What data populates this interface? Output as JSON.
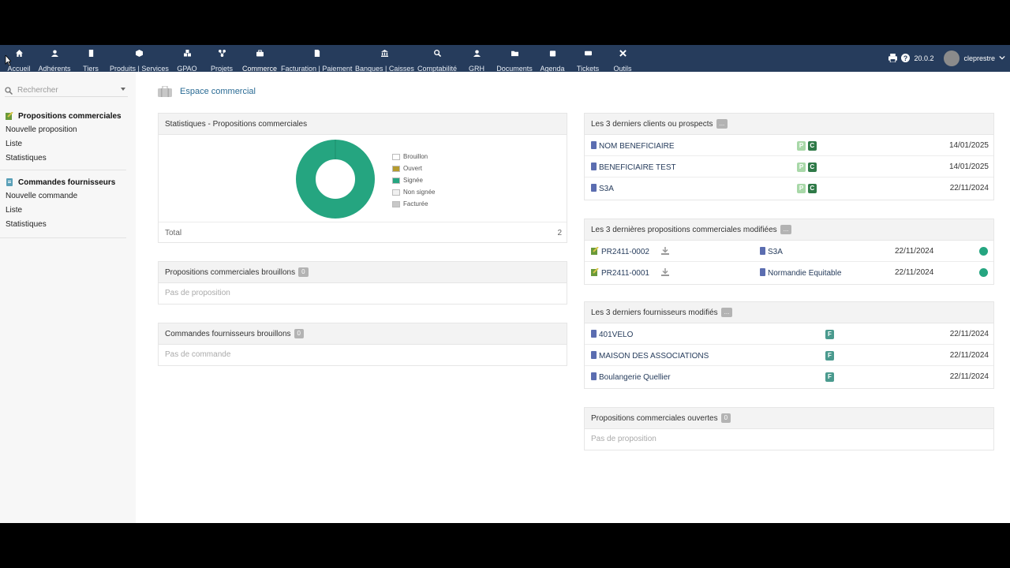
{
  "topbar": {
    "menu": [
      {
        "label": "Accueil",
        "icon": "home-icon"
      },
      {
        "label": "Adhérents",
        "icon": "user-icon"
      },
      {
        "label": "Tiers",
        "icon": "building-icon"
      },
      {
        "label": "Produits | Services",
        "icon": "cube-icon"
      },
      {
        "label": "GPAO",
        "icon": "cubes-icon"
      },
      {
        "label": "Projets",
        "icon": "project-icon"
      },
      {
        "label": "Commerce",
        "icon": "briefcase-icon"
      },
      {
        "label": "Facturation | Paiement",
        "icon": "invoice-icon"
      },
      {
        "label": "Banques | Caisses",
        "icon": "bank-icon"
      },
      {
        "label": "Comptabilité",
        "icon": "search-dollar-icon"
      },
      {
        "label": "GRH",
        "icon": "user-tie-icon"
      },
      {
        "label": "Documents",
        "icon": "folder-icon"
      },
      {
        "label": "Agenda",
        "icon": "calendar-icon"
      },
      {
        "label": "Tickets",
        "icon": "ticket-icon"
      },
      {
        "label": "Outils",
        "icon": "tools-icon"
      }
    ],
    "version": "20.0.2",
    "username": "cleprestre"
  },
  "sidebar": {
    "search_placeholder": "Rechercher",
    "sections": [
      {
        "title": "Propositions commerciales",
        "links": [
          "Nouvelle proposition",
          "Liste",
          "Statistiques"
        ]
      },
      {
        "title": "Commandes fournisseurs",
        "links": [
          "Nouvelle commande",
          "Liste",
          "Statistiques"
        ]
      }
    ]
  },
  "page": {
    "title": "Espace commercial"
  },
  "stats": {
    "title": "Statistiques - Propositions commerciales",
    "legend": [
      "Brouillon",
      "Ouvert",
      "Signée",
      "Non signée",
      "Facturée"
    ],
    "total_label": "Total",
    "total_value": "2",
    "colors": {
      "brouillon": "#ffffff",
      "ouvert": "#b59b2e",
      "signee": "#25a580",
      "non_signee": "#f0f0f0",
      "facturee": "#c8c8c8"
    }
  },
  "chart_data": {
    "type": "pie",
    "categories": [
      "Brouillon",
      "Ouvert",
      "Signée",
      "Non signée",
      "Facturée"
    ],
    "values": [
      0,
      0,
      2,
      0,
      0
    ]
  },
  "draft_proposals": {
    "title": "Propositions commerciales brouillons",
    "count": "0",
    "empty": "Pas de proposition"
  },
  "draft_orders": {
    "title": "Commandes fournisseurs brouillons",
    "count": "0",
    "empty": "Pas de commande"
  },
  "last_clients": {
    "title": "Les 3 derniers clients ou prospects",
    "badge": "...",
    "rows": [
      {
        "name": "NOM BENEFICIAIRE",
        "tag_p": "P",
        "tag_c": "C",
        "date": "14/01/2025"
      },
      {
        "name": "BENEFICIAIRE TEST",
        "tag_p": "P",
        "tag_c": "C",
        "date": "14/01/2025"
      },
      {
        "name": "S3A",
        "tag_p": "P",
        "tag_c": "C",
        "date": "22/11/2024"
      }
    ]
  },
  "last_proposals": {
    "title": "Les 3 dernières propositions commerciales modifiées",
    "badge": "...",
    "rows": [
      {
        "ref": "PR2411-0002",
        "thirdparty": "S3A",
        "date": "22/11/2024"
      },
      {
        "ref": "PR2411-0001",
        "thirdparty": "Normandie Equitable",
        "date": "22/11/2024"
      }
    ]
  },
  "last_suppliers": {
    "title": "Les 3 derniers fournisseurs modifiés",
    "badge": "...",
    "rows": [
      {
        "name": "401VELO",
        "tag": "F",
        "date": "22/11/2024"
      },
      {
        "name": "MAISON DES ASSOCIATIONS",
        "tag": "F",
        "date": "22/11/2024"
      },
      {
        "name": "Boulangerie Quellier",
        "tag": "F",
        "date": "22/11/2024"
      }
    ]
  },
  "open_proposals": {
    "title": "Propositions commerciales ouvertes",
    "count": "0",
    "empty": "Pas de proposition"
  }
}
